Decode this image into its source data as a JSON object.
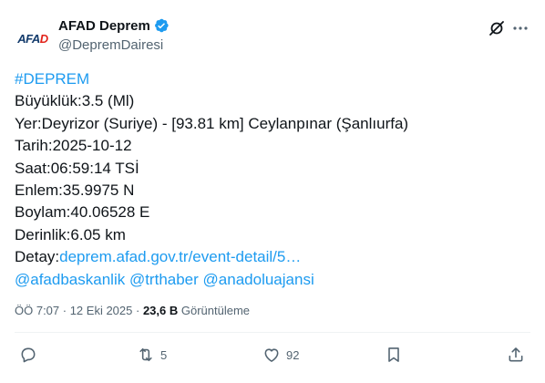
{
  "account": {
    "avatar_text_a": "AFA",
    "avatar_text_b": "D",
    "display_name": "AFAD Deprem",
    "handle": "@DepremDairesi"
  },
  "tweet": {
    "hashtag": "#DEPREM",
    "lines": [
      "Büyüklük:3.5 (Ml)",
      "Yer:Deyrizor (Suriye) - [93.81 km] Ceylanpınar (Şanlıurfa)",
      "Tarih:2025-10-12",
      "Saat:06:59:14 TSİ",
      "Enlem:35.9975 N",
      "Boylam:40.06528 E",
      "Derinlik:6.05 km"
    ],
    "detail_label": "Detay:",
    "detail_link": "deprem.afad.gov.tr/event-detail/5…",
    "mentions": [
      "@afadbaskanlik",
      "@trthaber",
      "@anadoluajansi"
    ]
  },
  "meta": {
    "time": "ÖÖ 7:07",
    "separator": " · ",
    "date": "12 Eki 2025",
    "views_count": "23,6 B",
    "views_label": " Görüntüleme"
  },
  "actions": {
    "replies": "",
    "reposts": "5",
    "likes": "92"
  },
  "colors": {
    "accent": "#1d9bf0",
    "text": "#0f1419",
    "muted": "#536471",
    "border": "#eff3f4"
  }
}
